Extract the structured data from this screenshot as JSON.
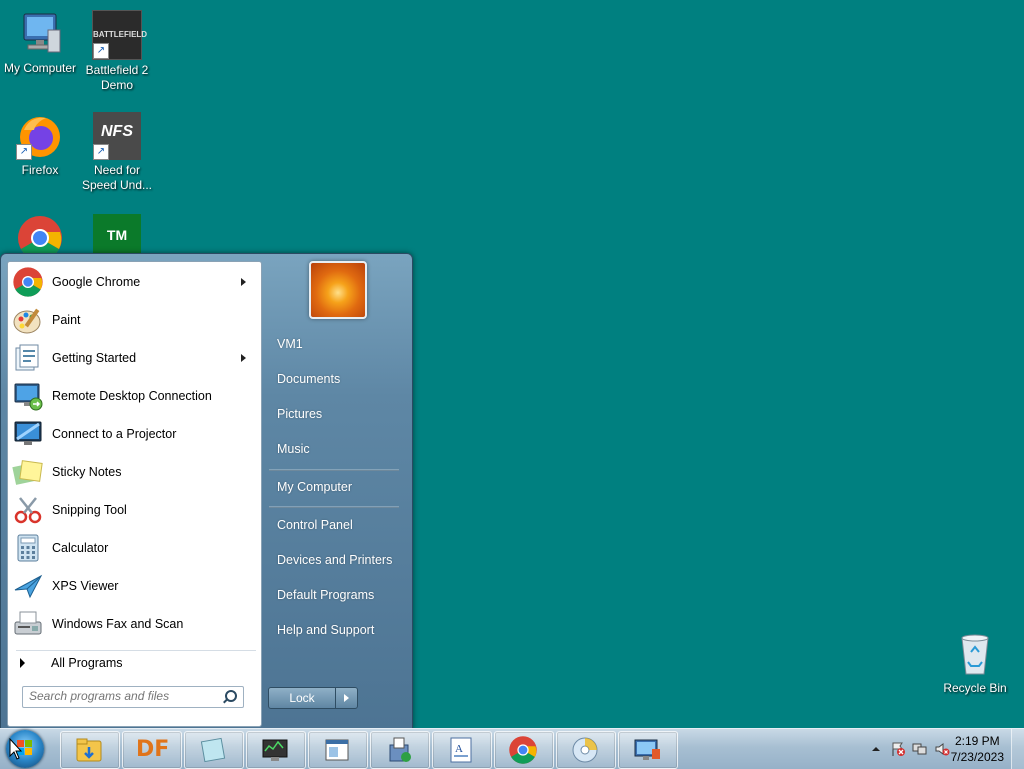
{
  "desktop": {
    "icons": [
      {
        "label": "My Computer"
      },
      {
        "label": "Battlefield 2 Demo",
        "image_text": "BATTLEFIELD"
      },
      {
        "label": "Firefox"
      },
      {
        "label": "Need for Speed Und...",
        "image_text": "NFS"
      },
      {
        "label": ""
      },
      {
        "label": "",
        "image_text": "TM"
      },
      {
        "label": "Recycle Bin"
      }
    ]
  },
  "start_menu": {
    "programs": [
      {
        "label": "Google Chrome",
        "icon": "chrome-icon",
        "has_submenu": true
      },
      {
        "label": "Paint",
        "icon": "paint-icon",
        "has_submenu": false
      },
      {
        "label": "Getting Started",
        "icon": "getting-started-icon",
        "has_submenu": true
      },
      {
        "label": "Remote Desktop Connection",
        "icon": "remote-desktop-icon",
        "has_submenu": false
      },
      {
        "label": "Connect to a Projector",
        "icon": "projector-icon",
        "has_submenu": false
      },
      {
        "label": "Sticky Notes",
        "icon": "sticky-notes-icon",
        "has_submenu": false
      },
      {
        "label": "Snipping Tool",
        "icon": "scissors-icon",
        "has_submenu": false
      },
      {
        "label": "Calculator",
        "icon": "calculator-icon",
        "has_submenu": false
      },
      {
        "label": "XPS Viewer",
        "icon": "xps-viewer-icon",
        "has_submenu": false
      },
      {
        "label": "Windows Fax and Scan",
        "icon": "fax-icon",
        "has_submenu": false
      }
    ],
    "all_programs_label": "All Programs",
    "search_placeholder": "Search programs and files",
    "right_items": [
      {
        "label": "VM1"
      },
      {
        "label": "Documents"
      },
      {
        "label": "Pictures"
      },
      {
        "label": "Music"
      },
      {
        "label": "My Computer"
      },
      {
        "label": "Control Panel"
      },
      {
        "label": "Devices and Printers"
      },
      {
        "label": "Default Programs"
      },
      {
        "label": "Help and Support"
      }
    ],
    "lock_label": "Lock"
  },
  "taskbar": {
    "pinned": [
      {
        "icon": "explorer-folder-icon"
      },
      {
        "icon": "df-icon",
        "text": "DF"
      },
      {
        "icon": "notes-app-icon"
      },
      {
        "icon": "monitor-app-icon"
      },
      {
        "icon": "window-app-icon"
      },
      {
        "icon": "installer-icon"
      },
      {
        "icon": "document-app-icon"
      },
      {
        "icon": "chrome-icon"
      },
      {
        "icon": "dvd-icon"
      },
      {
        "icon": "remote-app-icon"
      }
    ],
    "clock_time": "2:19 PM",
    "clock_date": "7/23/2023"
  },
  "colors": {
    "desktop_bg": "#008080",
    "start_menu_blue": "#5e87a5"
  }
}
